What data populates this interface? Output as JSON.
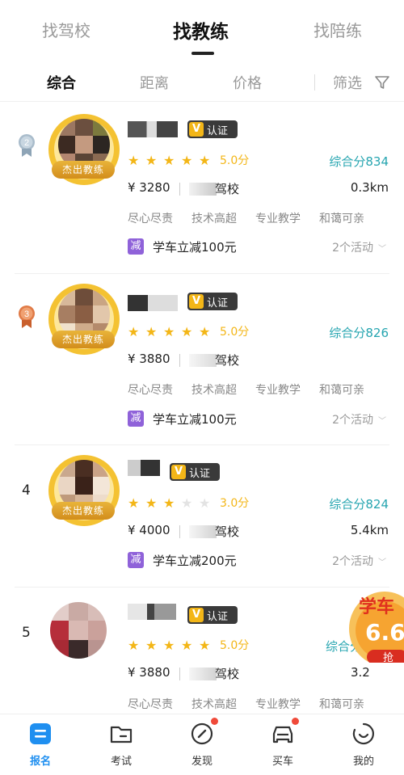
{
  "top_tabs": [
    "找驾校",
    "找教练",
    "找陪练"
  ],
  "sort": {
    "items": [
      "综合",
      "距离",
      "价格"
    ],
    "filter_label": "筛选"
  },
  "cards": [
    {
      "rank": "2",
      "badge": "杰出教练",
      "cert": "认证",
      "cert_v": "V",
      "stars": [
        "★",
        "★",
        "★",
        "★",
        "★"
      ],
      "rating": "5.0分",
      "composite": "综合分834",
      "price": "¥ 3280",
      "school": "驾校",
      "distance": "0.3km",
      "tags": [
        "尽心尽责",
        "技术高超",
        "专业教学",
        "和蔼可亲"
      ],
      "promo_badge": "减",
      "promo": "学车立减100元",
      "activities": "2个活动"
    },
    {
      "rank": "3",
      "badge": "杰出教练",
      "cert": "认证",
      "cert_v": "V",
      "stars": [
        "★",
        "★",
        "★",
        "★",
        "★"
      ],
      "rating": "5.0分",
      "composite": "综合分826",
      "price": "¥ 3880",
      "school": "驾校",
      "distance": "",
      "tags": [
        "尽心尽责",
        "技术高超",
        "专业教学",
        "和蔼可亲"
      ],
      "promo_badge": "减",
      "promo": "学车立减100元",
      "activities": "2个活动"
    },
    {
      "rank": "4",
      "badge": "杰出教练",
      "cert": "认证",
      "cert_v": "V",
      "stars": [
        "★",
        "★",
        "★",
        "★",
        "★"
      ],
      "rating": "3.0分",
      "composite": "综合分824",
      "price": "¥ 4000",
      "school": "驾校",
      "distance": "5.4km",
      "promo_badge": "减",
      "promo": "学车立减200元",
      "activities": "2个活动"
    },
    {
      "rank": "5",
      "cert": "认证",
      "cert_v": "V",
      "stars": [
        "★",
        "★",
        "★",
        "★",
        "★"
      ],
      "rating": "5.0分",
      "composite": "综合分",
      "price": "¥ 3880",
      "school": "驾校",
      "distance": "3.2",
      "tags": [
        "尽心尽责",
        "技术高超",
        "专业教学",
        "和蔼可亲"
      ]
    }
  ],
  "float_ad": {
    "line1": "学车",
    "line2": "6.6",
    "line3": "抢"
  },
  "bottom_nav": [
    "报名",
    "考试",
    "发现",
    "买车",
    "我的"
  ],
  "colors": {
    "accent_teal": "#26a5b0",
    "star_gold": "#f3b617",
    "promo_purple": "#8f62d9",
    "nav_blue": "#1f8ff0",
    "dot_red": "#f04a3a"
  }
}
